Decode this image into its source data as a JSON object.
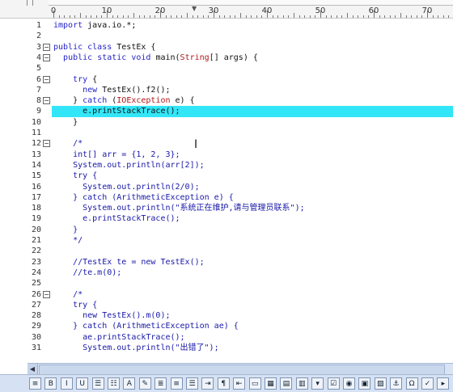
{
  "ruler": {
    "labels": [
      "0",
      "10",
      "20",
      "30",
      "40",
      "50",
      "60",
      "70"
    ]
  },
  "editor": {
    "lines": [
      {
        "n": "1",
        "fold": "",
        "segs": [
          [
            "kw",
            "import"
          ],
          [
            "t",
            " java.io.*;"
          ]
        ]
      },
      {
        "n": "2",
        "fold": "",
        "segs": []
      },
      {
        "n": "3",
        "fold": "⊟",
        "segs": [
          [
            "kw",
            "public class"
          ],
          [
            "t",
            " TestEx {"
          ]
        ]
      },
      {
        "n": "4",
        "fold": "⊟",
        "segs": [
          [
            "t",
            "  "
          ],
          [
            "kw",
            "public static void"
          ],
          [
            "t",
            " main("
          ],
          [
            "ty",
            "String"
          ],
          [
            "t",
            "[] args) {"
          ]
        ]
      },
      {
        "n": "5",
        "fold": "",
        "segs": []
      },
      {
        "n": "6",
        "fold": "⊟",
        "segs": [
          [
            "t",
            "    "
          ],
          [
            "kw",
            "try"
          ],
          [
            "t",
            " {"
          ]
        ]
      },
      {
        "n": "7",
        "fold": "",
        "segs": [
          [
            "t",
            "      "
          ],
          [
            "kw",
            "new"
          ],
          [
            "t",
            " TestEx().f2();"
          ]
        ]
      },
      {
        "n": "8",
        "fold": "⊟",
        "segs": [
          [
            "t",
            "    } "
          ],
          [
            "kw",
            "catch"
          ],
          [
            "t",
            " ("
          ],
          [
            "ty",
            "IOException"
          ],
          [
            "t",
            " e) {"
          ]
        ]
      },
      {
        "n": "9",
        "fold": "",
        "segs": [
          [
            "t",
            "      e.printStackTrace();"
          ]
        ],
        "highlight": true
      },
      {
        "n": "10",
        "fold": "",
        "segs": [
          [
            "t",
            "    }"
          ]
        ]
      },
      {
        "n": "11",
        "fold": "",
        "segs": []
      },
      {
        "n": "12",
        "fold": "⊟",
        "segs": [
          [
            "cm",
            "    /*"
          ]
        ]
      },
      {
        "n": "13",
        "fold": "",
        "segs": [
          [
            "cm",
            "    int[] arr = {1, 2, 3};"
          ]
        ]
      },
      {
        "n": "14",
        "fold": "",
        "segs": [
          [
            "cm",
            "    System.out.println(arr[2]);"
          ]
        ]
      },
      {
        "n": "15",
        "fold": "",
        "segs": [
          [
            "cm",
            "    try {"
          ]
        ]
      },
      {
        "n": "16",
        "fold": "",
        "segs": [
          [
            "cm",
            "      System.out.println(2/0);"
          ]
        ]
      },
      {
        "n": "17",
        "fold": "",
        "segs": [
          [
            "cm",
            "    } catch (ArithmeticException e) {"
          ]
        ]
      },
      {
        "n": "18",
        "fold": "",
        "segs": [
          [
            "cm",
            "      System.out.println(\"系统正在维护,请与管理员联系\");"
          ]
        ]
      },
      {
        "n": "19",
        "fold": "",
        "segs": [
          [
            "cm",
            "      e.printStackTrace();"
          ]
        ]
      },
      {
        "n": "20",
        "fold": "",
        "segs": [
          [
            "cm",
            "    }"
          ]
        ]
      },
      {
        "n": "21",
        "fold": "",
        "segs": [
          [
            "cm",
            "    */"
          ]
        ]
      },
      {
        "n": "22",
        "fold": "",
        "segs": []
      },
      {
        "n": "23",
        "fold": "",
        "segs": [
          [
            "cm",
            "    //TestEx te = new TestEx();"
          ]
        ]
      },
      {
        "n": "24",
        "fold": "",
        "segs": [
          [
            "cm",
            "    //te.m(0);"
          ]
        ]
      },
      {
        "n": "25",
        "fold": "",
        "segs": []
      },
      {
        "n": "26",
        "fold": "⊟",
        "segs": [
          [
            "cm",
            "    /*"
          ]
        ]
      },
      {
        "n": "27",
        "fold": "",
        "segs": [
          [
            "cm",
            "    try {"
          ]
        ]
      },
      {
        "n": "28",
        "fold": "",
        "segs": [
          [
            "cm",
            "      new TestEx().m(0);"
          ]
        ]
      },
      {
        "n": "29",
        "fold": "",
        "segs": [
          [
            "cm",
            "    } catch (ArithmeticException ae) {"
          ]
        ]
      },
      {
        "n": "30",
        "fold": "",
        "segs": [
          [
            "cm",
            "      ae.printStackTrace();"
          ]
        ]
      },
      {
        "n": "31",
        "fold": "",
        "segs": [
          [
            "cm",
            "      System.out.println(\"出错了\");"
          ]
        ]
      }
    ]
  },
  "colors": {
    "highlight": "#33e6f7",
    "keyword": "#2323c8",
    "type": "#b01818",
    "comment": "#1818a8"
  },
  "toolbar": {
    "buttons": [
      {
        "name": "align-left-button",
        "glyph": "≡"
      },
      {
        "name": "bold-button",
        "glyph": "B"
      },
      {
        "name": "italic-button",
        "glyph": "I"
      },
      {
        "name": "underline-button",
        "glyph": "U"
      },
      {
        "name": "bullet-list-button",
        "glyph": "☰"
      },
      {
        "name": "numbered-list-button",
        "glyph": "☷"
      },
      {
        "name": "font-button",
        "glyph": "A"
      },
      {
        "name": "highlight-button",
        "glyph": "✎"
      },
      {
        "name": "align-center-button",
        "glyph": "≣"
      },
      {
        "name": "align-right-button",
        "glyph": "≡"
      },
      {
        "name": "justify-button",
        "glyph": "☰"
      },
      {
        "name": "indent-button",
        "glyph": "⇥"
      },
      {
        "name": "paragraph-button",
        "glyph": "¶"
      },
      {
        "name": "outdent-button",
        "glyph": "⇤"
      },
      {
        "name": "border-button",
        "glyph": "▭"
      },
      {
        "name": "table-button",
        "glyph": "▦"
      },
      {
        "name": "text-box-button",
        "glyph": "▤"
      },
      {
        "name": "form-field-button",
        "glyph": "▥"
      },
      {
        "name": "dropdown-field-button",
        "glyph": "▾"
      },
      {
        "name": "checkbox-button",
        "glyph": "☑"
      },
      {
        "name": "radio-button",
        "glyph": "◉"
      },
      {
        "name": "frame-button",
        "glyph": "▣"
      },
      {
        "name": "image-button",
        "glyph": "▨"
      },
      {
        "name": "anchor-button",
        "glyph": "⚓"
      },
      {
        "name": "symbol-button",
        "glyph": "Ω"
      },
      {
        "name": "spell-check-button",
        "glyph": "✓"
      },
      {
        "name": "more-button",
        "glyph": "▸"
      }
    ]
  }
}
